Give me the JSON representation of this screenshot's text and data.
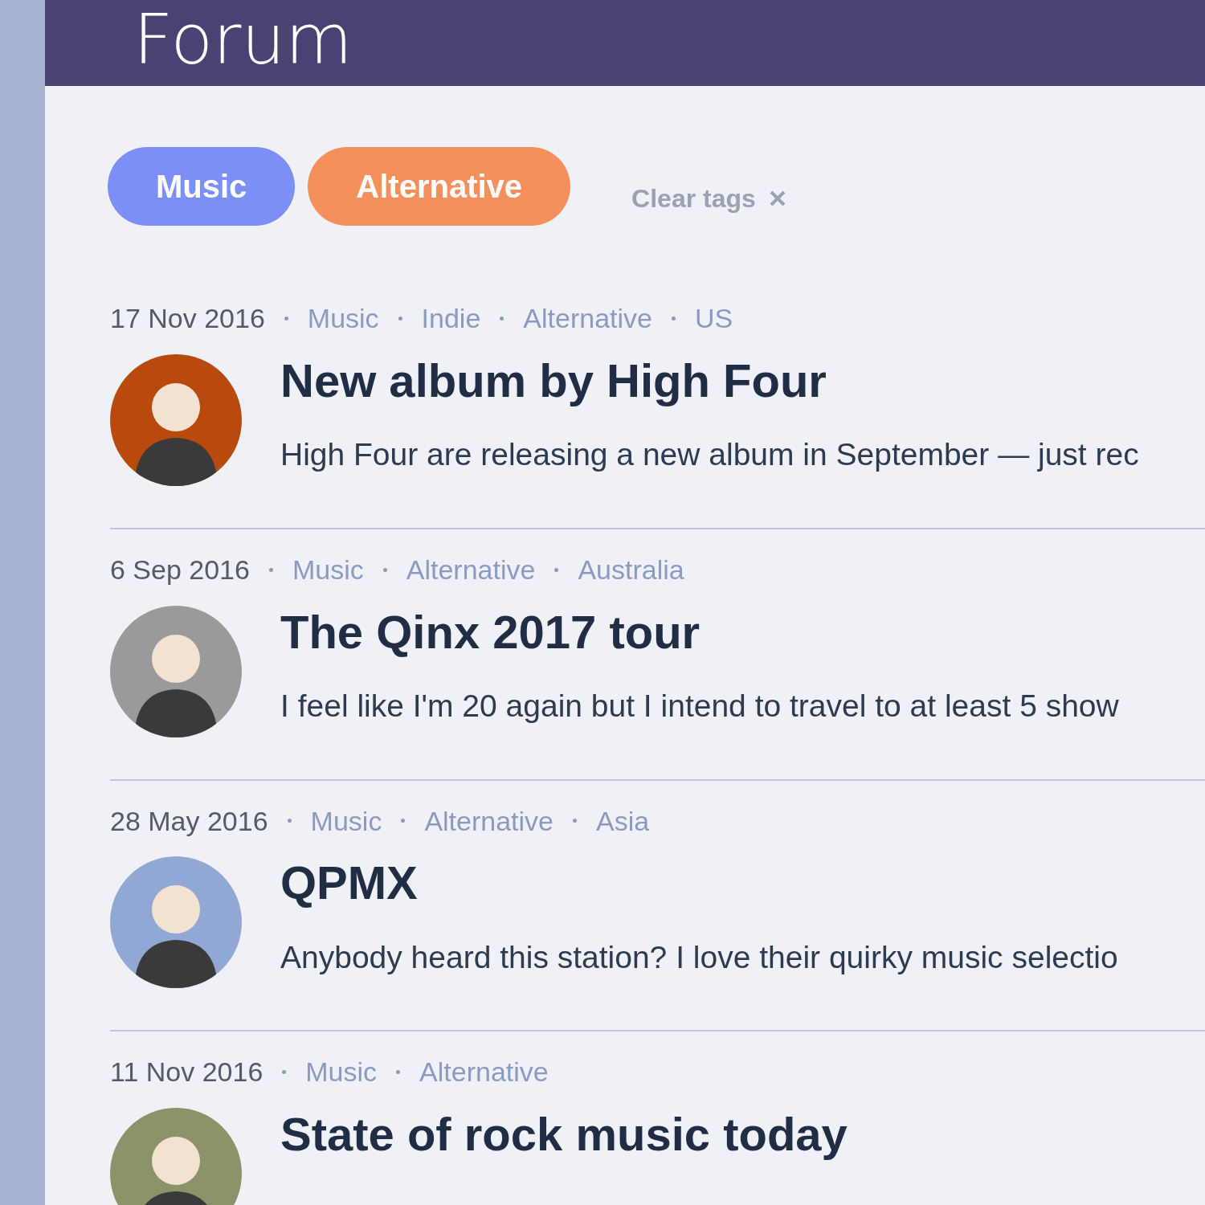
{
  "header": {
    "title": "Forum"
  },
  "filter_tags": [
    {
      "label": "Music",
      "color": "#7b8ff7"
    },
    {
      "label": "Alternative",
      "color": "#f4905c"
    }
  ],
  "clear_tags": {
    "label": "Clear tags"
  },
  "posts": [
    {
      "date": "17 Nov 2016",
      "tags": [
        "Music",
        "Indie",
        "Alternative",
        "US"
      ],
      "title": "New album by High Four",
      "excerpt": "High Four are releasing a new album in September — just rec",
      "color": "#b84a0e"
    },
    {
      "date": "6 Sep 2016",
      "tags": [
        "Music",
        "Alternative",
        "Australia"
      ],
      "title": "The Qinx 2017 tour",
      "excerpt": "I feel like I'm 20 again but I intend to travel to at least 5 show",
      "color": "#9a9a9a"
    },
    {
      "date": "28 May 2016",
      "tags": [
        "Music",
        "Alternative",
        "Asia"
      ],
      "title": "QPMX",
      "excerpt": "Anybody heard this station? I love their quirky music selectio",
      "color": "#92a8d4"
    },
    {
      "date": "11 Nov 2016",
      "tags": [
        "Music",
        "Alternative"
      ],
      "title": "State of rock music today",
      "color": "#8a9468"
    }
  ]
}
